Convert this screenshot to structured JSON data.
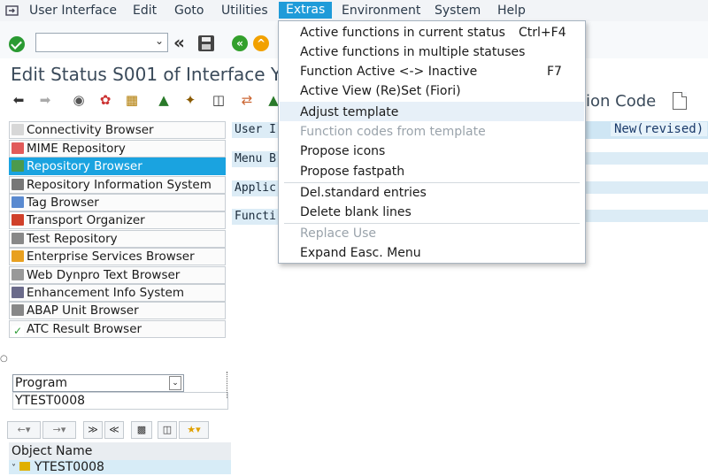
{
  "menubar": {
    "items": [
      "User Interface",
      "Edit",
      "Goto",
      "Utilities",
      "Extras",
      "Environment",
      "System",
      "Help"
    ],
    "active_index": 4
  },
  "page_title": "Edit Status S001 of Interface Y",
  "toolbar": {
    "function_code_label": "ion Code"
  },
  "left_nav": {
    "items": [
      "Connectivity Browser",
      "MIME Repository",
      "Repository Browser",
      "Repository Information System",
      "Tag Browser",
      "Transport Organizer",
      "Test Repository",
      "Enterprise Services Browser",
      "Web Dynpro Text Browser",
      "Enhancement Info System",
      "ABAP Unit Browser",
      "ATC Result Browser"
    ],
    "selected_index": 2,
    "object_type_select": "Program",
    "object_name_value": "YTEST0008",
    "list_header": "Object Name",
    "tree_item": "YTEST0008"
  },
  "content": {
    "fields": [
      "User I",
      "Menu B",
      "Applic",
      "Functi"
    ],
    "status": "New(revised)"
  },
  "extras_menu": {
    "items": [
      {
        "label": "Active functions in current status",
        "shortcut": "Ctrl+F4",
        "disabled": false
      },
      {
        "label": "Active functions in multiple statuses",
        "shortcut": "",
        "disabled": false
      },
      {
        "label": "Function Active <-> Inactive",
        "shortcut": "F7",
        "disabled": false
      },
      {
        "label": "Active View (Re)Set (Fiori)",
        "shortcut": "",
        "disabled": false
      },
      {
        "label": "Adjust template",
        "shortcut": "",
        "disabled": false
      },
      {
        "label": "Function codes from template",
        "shortcut": "",
        "disabled": true
      },
      {
        "label": "Propose icons",
        "shortcut": "",
        "disabled": false
      },
      {
        "label": "Propose fastpath",
        "shortcut": "",
        "disabled": false
      },
      {
        "label": "Del.standard entries",
        "shortcut": "",
        "disabled": false
      },
      {
        "label": "Delete blank lines",
        "shortcut": "",
        "disabled": false
      },
      {
        "label": "Replace Use",
        "shortcut": "",
        "disabled": true
      },
      {
        "label": "Expand Easc. Menu",
        "shortcut": "",
        "disabled": false
      }
    ],
    "highlighted_index": 4
  },
  "colors": {
    "accent": "#1f9bd9",
    "selected_nav": "#1aa3e0",
    "field_band": "#dcecf6"
  }
}
